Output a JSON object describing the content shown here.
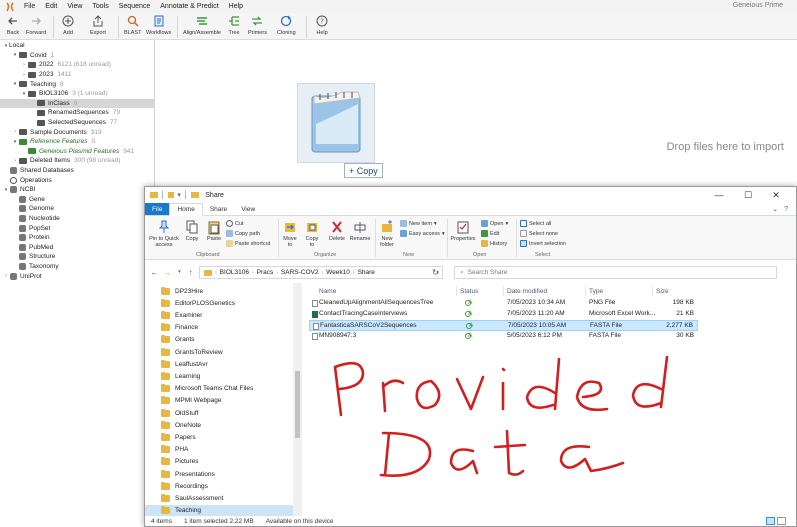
{
  "app": {
    "name": "Geneious Prime",
    "menu": [
      "File",
      "Edit",
      "View",
      "Tools",
      "Sequence",
      "Annotate & Predict",
      "Help"
    ],
    "toolbar": [
      "Back",
      "Forward",
      "Add",
      "Export",
      "BLAST",
      "Workflows",
      "Align/Assemble",
      "Tree",
      "Primers",
      "Cloning",
      "Help"
    ],
    "tree": [
      {
        "label": "Local",
        "count": "",
        "level": 0,
        "arrow": "▾",
        "icon": "none"
      },
      {
        "label": "Covid",
        "count": "1",
        "level": 1,
        "arrow": "▾",
        "icon": "folder"
      },
      {
        "label": "2022",
        "count": "6121 (618 unread)",
        "level": 2,
        "arrow": "›",
        "icon": "folder"
      },
      {
        "label": "2023",
        "count": "1411",
        "level": 2,
        "arrow": "›",
        "icon": "folder"
      },
      {
        "label": "Teaching",
        "count": "8",
        "level": 1,
        "arrow": "▾",
        "icon": "folder"
      },
      {
        "label": "BIOL3106",
        "count": "3 (1 unread)",
        "level": 2,
        "arrow": "▾",
        "icon": "folder"
      },
      {
        "label": "InClass",
        "count": "0",
        "level": 3,
        "arrow": "",
        "icon": "folder",
        "selected": true
      },
      {
        "label": "RenamedSequences",
        "count": "79",
        "level": 3,
        "arrow": "",
        "icon": "folder"
      },
      {
        "label": "SelectedSequences",
        "count": "77",
        "level": 3,
        "arrow": "",
        "icon": "folder"
      },
      {
        "label": "Sample Documents",
        "count": "319",
        "level": 1,
        "arrow": "›",
        "icon": "folder"
      },
      {
        "label": "Reference Features",
        "count": "0",
        "level": 1,
        "arrow": "▾",
        "icon": "green",
        "italic": true
      },
      {
        "label": "Geneious Plasmid Features",
        "count": "941",
        "level": 2,
        "arrow": "",
        "icon": "green",
        "italic": true
      },
      {
        "label": "Deleted Items",
        "count": "300 (98 unread)",
        "level": 1,
        "arrow": "›",
        "icon": "folder"
      },
      {
        "label": "Shared Databases",
        "count": "",
        "level": 0,
        "arrow": "",
        "icon": "db"
      },
      {
        "label": "Operations",
        "count": "",
        "level": 0,
        "arrow": "",
        "icon": "ops"
      },
      {
        "label": "NCBI",
        "count": "",
        "level": 0,
        "arrow": "▾",
        "icon": "db"
      },
      {
        "label": "Gene",
        "count": "",
        "level": 1,
        "arrow": "",
        "icon": "db"
      },
      {
        "label": "Genome",
        "count": "",
        "level": 1,
        "arrow": "",
        "icon": "db"
      },
      {
        "label": "Nucleotide",
        "count": "",
        "level": 1,
        "arrow": "",
        "icon": "db"
      },
      {
        "label": "PopSet",
        "count": "",
        "level": 1,
        "arrow": "",
        "icon": "db"
      },
      {
        "label": "Protein",
        "count": "",
        "level": 1,
        "arrow": "",
        "icon": "db"
      },
      {
        "label": "PubMed",
        "count": "",
        "level": 1,
        "arrow": "",
        "icon": "db"
      },
      {
        "label": "Structure",
        "count": "",
        "level": 1,
        "arrow": "",
        "icon": "db"
      },
      {
        "label": "Taxonomy",
        "count": "",
        "level": 1,
        "arrow": "",
        "icon": "db"
      },
      {
        "label": "UniProt",
        "count": "",
        "level": 0,
        "arrow": "›",
        "icon": "db"
      }
    ],
    "drop_hint": "Drop files here to import",
    "copy_badge": "+ Copy"
  },
  "explorer": {
    "title": "Share",
    "tabs": [
      "File",
      "Home",
      "Share",
      "View"
    ],
    "ribbon": {
      "clipboard": {
        "group": "Clipboard",
        "pin": "Pin to Quick access",
        "copy": "Copy",
        "paste": "Paste",
        "cut": "Cut",
        "copy_path": "Copy path",
        "paste_shortcut": "Paste shortcut"
      },
      "organize": {
        "group": "Organize",
        "move_to": "Move to",
        "copy_to": "Copy to",
        "delete": "Delete",
        "rename": "Rename"
      },
      "new": {
        "group": "New",
        "new_folder": "New folder",
        "new_item": "New item",
        "easy_access": "Easy access"
      },
      "open": {
        "group": "Open",
        "properties": "Properties",
        "open": "Open",
        "edit": "Edit",
        "history": "History"
      },
      "select": {
        "group": "Select",
        "select_all": "Select all",
        "select_none": "Select none",
        "invert": "Invert selection"
      }
    },
    "breadcrumb": [
      "BIOL3106",
      "Pracs",
      "SARS-COV2",
      "Week10",
      "Share"
    ],
    "search_placeholder": "Search Share",
    "nav_items": [
      "DP23Hire",
      "EditorPLOSGenetics",
      "Examiner",
      "Finance",
      "Grants",
      "GrantsToReview",
      "LeaffustAvr",
      "Learning",
      "Microsoft Teams Chat Files",
      "MPMI Webpage",
      "OldStuff",
      "OneNote",
      "Papers",
      "PHA",
      "Pictures",
      "Presentations",
      "Recordings",
      "SaulAssessment",
      "Teaching"
    ],
    "columns": {
      "name": "Name",
      "status": "Status",
      "date": "Date modified",
      "type": "Type",
      "size": "Size"
    },
    "files": [
      {
        "name": "CleanedUpAlignmentAllSequencesTree",
        "status": "A",
        "date": "7/05/2023 10:34 AM",
        "type": "PNG File",
        "size": "198 KB",
        "icon": "png"
      },
      {
        "name": "ContactTracingCaseInterviews",
        "status": "A",
        "date": "7/05/2023 11:20 AM",
        "type": "Microsoft Excel Work...",
        "size": "21 KB",
        "icon": "excel"
      },
      {
        "name": "FantasticaSARSCoV2Sequences",
        "status": "A",
        "date": "7/05/2023 10:05 AM",
        "type": "FASTA File",
        "size": "2,277 KB",
        "icon": "fasta",
        "selected": true
      },
      {
        "name": "MN908947.3",
        "status": "A",
        "date": "5/05/2023 6:12 PM",
        "type": "FASTA File",
        "size": "30 KB",
        "icon": "fasta"
      }
    ],
    "status_bar": {
      "items": "4 items",
      "selected": "1 item selected  2.22 MB",
      "availability": "Available on this device"
    }
  }
}
